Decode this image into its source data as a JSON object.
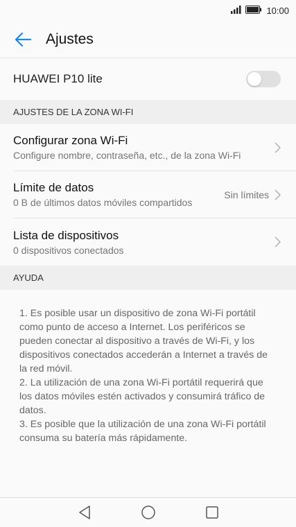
{
  "status_bar": {
    "time": "10:00"
  },
  "app_bar": {
    "title": "Ajustes"
  },
  "device": {
    "name": "HUAWEI P10 lite",
    "hotspot_enabled": false
  },
  "sections": {
    "hotspot_header": "AJUSTES DE LA ZONA WI-FI",
    "help_header": "AYUDA"
  },
  "items": [
    {
      "title": "Configurar zona Wi-Fi",
      "subtitle": "Configure nombre, contraseña, etc., de la zona Wi-Fi",
      "value": ""
    },
    {
      "title": "Límite de datos",
      "subtitle": "0 B de últimos datos móviles compartidos",
      "value": "Sin límites"
    },
    {
      "title": "Lista de dispositivos",
      "subtitle": "0 dispositivos conectados",
      "value": ""
    }
  ],
  "help": [
    "1. Es posible usar un dispositivo de zona Wi-Fi portátil como punto de acceso a Internet. Los periféricos se pueden conectar al dispositivo a través de Wi-Fi, y los dispositivos conectados accederán a Internet a través de la red móvil.",
    "2. La utilización de una zona Wi-Fi portátil requerirá que los datos móviles estén activados y consumirá tráfico de datos.",
    "3. Es posible que la utilización de una zona Wi-Fi portátil consuma su batería más rápidamente."
  ],
  "colors": {
    "accent": "#1e88e5",
    "background": "#fafafa",
    "section_bg": "#efefef"
  },
  "icons": {
    "back": "arrow-left-icon",
    "chevron": "chevron-right-icon",
    "signal": "signal-icon",
    "battery": "battery-icon"
  }
}
